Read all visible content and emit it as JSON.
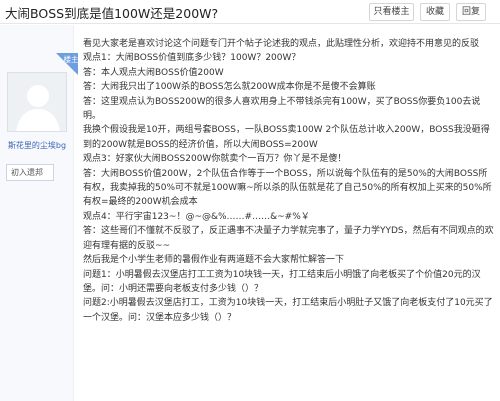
{
  "header": {
    "title": "大闹BOSS到底是值100W还是200W?",
    "buttons": [
      "只看楼主",
      "收藏",
      "回复"
    ]
  },
  "author": {
    "floor_label": "楼主",
    "name": "斯花里的尘埃bg",
    "level": "初入遗邦"
  },
  "post": {
    "paragraphs": [
      "看见大家老是喜欢讨论这个问题专门开个帖子论述我的观点，此贴理性分析，欢迎持不用意见的反驳",
      "观点1：大闹BOSS价值到底多少钱？100W？200W？",
      "答：本人观点大闹BOSS价值200W",
      "答：大闹我只出了100W杀的BOSS怎么就200W成本你是不是傻不会算账",
      "答：这里观点认为BOSS200W的很多人喜欢用身上不带钱杀完有100W，买了BOSS你要负100去说明。",
      "我换个假设我是10开，两组号套BOSS，一队BOSS卖100W 2个队伍总计收入200W，BOSS我没砸得到的200W就是BOSS的经济价值，所以大闹BOSS=200W",
      "观点3：好家伙大闹BOSS200W你就卖个一百万？你丫是不是傻！",
      "答：大闹BOSS价值200W，2个队伍合作等于一个BOSS，所以说每个队伍有的是50%的大闹BOSS所有权，我卖掉我的50%可不就是100W嘛~所以杀的队伍就是花了自己50%的所有权加上买来的50%所有权=最终的200W机会成本",
      "观点4：平行宇宙123~！@~@&%……#……&~#%￥",
      "答：这些哥们不懂就不反驳了，反正遇事不决量子力学就完事了，量子力学YYDS，然后有不同观点的欢迎有理有据的反驳~~",
      "然后我是个小学生老师的暑假作业有两道题不会大家帮忙解答一下",
      "问题1：小明暑假去汉堡店打工工资为10块钱一天，打工结束后小明饿了向老板买了个价值20元的汉堡。问：小明还需要向老板支付多少钱（）？",
      "问题2:小明暑假去汉堡店打工，工资为10块钱一天，打工结束后小明肚子又饿了向老板支付了10元买了一个汉堡。问：汉堡本应多少钱（）？"
    ]
  },
  "colors": {
    "accent": "#6f9ee0",
    "username": "#3a64b8",
    "text": "#333333"
  },
  "icons": {
    "avatar": "default-avatar-silhouette"
  }
}
